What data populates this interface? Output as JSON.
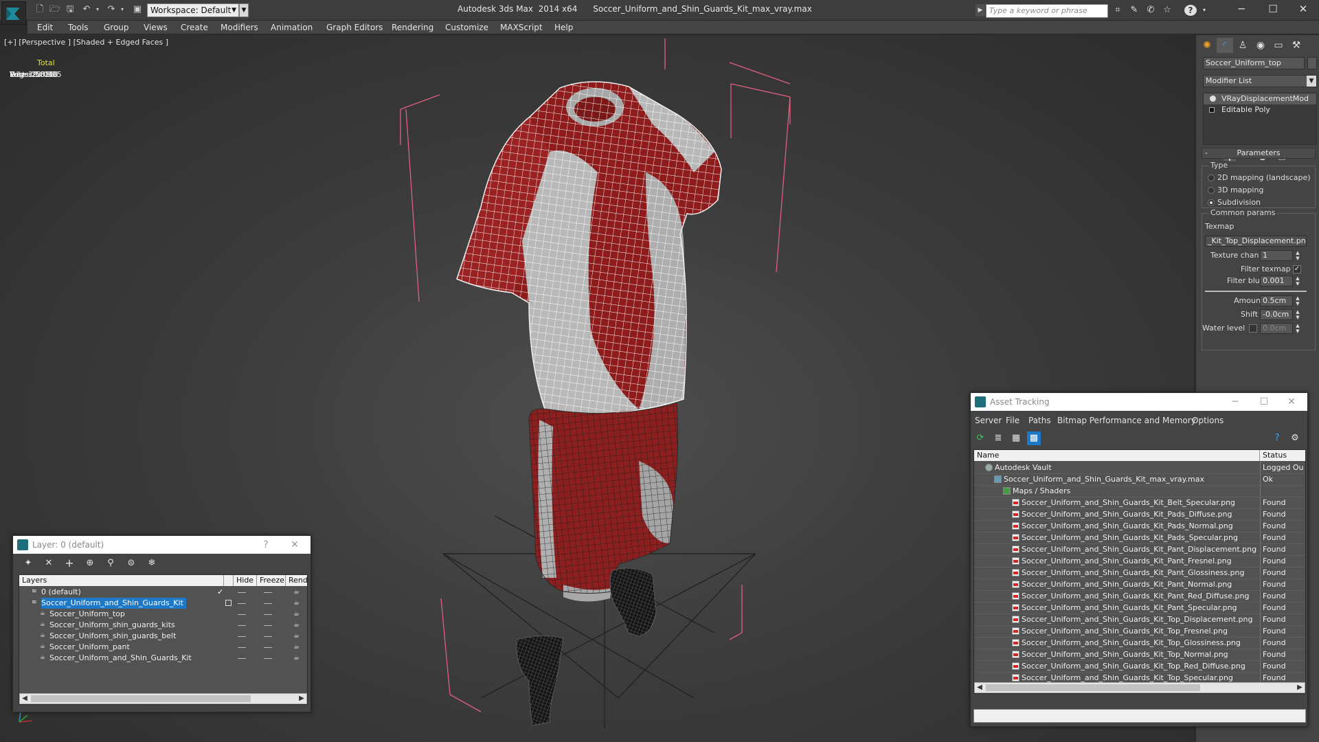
{
  "titlebar": {
    "workspace": "Workspace: Default",
    "app_title": "Autodesk 3ds Max  2014 x64      Soccer_Uniform_and_Shin_Guards_Kit_max_vray.max",
    "search_placeholder": "Type a keyword or phrase"
  },
  "menu": [
    "Edit",
    "Tools",
    "Group",
    "Views",
    "Create",
    "Modifiers",
    "Animation",
    "Graph Editors",
    "Rendering",
    "Customize",
    "MAXScript",
    "Help"
  ],
  "viewport": {
    "label": "[+] [Perspective ] [Shaded + Edged Faces ]",
    "stats": {
      "header": "Total",
      "rows": [
        {
          "k": "Polys:",
          "v": "22 018"
        },
        {
          "k": "Tris:",
          "v": "29 686"
        },
        {
          "k": "Edges:",
          "v": "58 305"
        },
        {
          "k": "Verts:",
          "v": "15 045"
        }
      ]
    }
  },
  "command_panel": {
    "object_name": "Soccer_Uniform_top",
    "modifier_list": "Modifier List",
    "stack": [
      "VRayDisplacementMod",
      "Editable Poly"
    ],
    "parameters_title": "Parameters",
    "type_title": "Type",
    "type_options": [
      "2D mapping (landscape)",
      "3D mapping",
      "Subdivision"
    ],
    "type_selected": 2,
    "common_title": "Common params",
    "texmap_label": "Texmap",
    "texmap_value": "_Kit_Top_Displacement.png)",
    "texture_chan_label": "Texture chan",
    "texture_chan_value": "1",
    "filter_texmap_label": "Filter texmap",
    "filter_blur_label": "Filter blur",
    "filter_blur_value": "0.001",
    "amount_label": "Amount",
    "amount_value": "0.5cm",
    "shift_label": "Shift",
    "shift_value": "-0.0cm",
    "water_label": "Water level",
    "water_value": "0.0cm"
  },
  "layer_dialog": {
    "title": "Layer: 0 (default)",
    "help": "?",
    "close": "✕",
    "columns": [
      "Layers",
      "Hide",
      "Freeze",
      "Render"
    ],
    "rows": [
      {
        "name": "0 (default)",
        "level": 0,
        "checked": true,
        "selected": false
      },
      {
        "name": "Soccer_Uniform_and_Shin_Guards_Kit",
        "level": 0,
        "checked": false,
        "selected": true
      },
      {
        "name": "Soccer_Uniform_top",
        "level": 1,
        "checked": false,
        "selected": false
      },
      {
        "name": "Soccer_Uniform_shin_guards_kits",
        "level": 1,
        "checked": false,
        "selected": false
      },
      {
        "name": "Soccer_Uniform_shin_guards_belt",
        "level": 1,
        "checked": false,
        "selected": false
      },
      {
        "name": "Soccer_Uniform_pant",
        "level": 1,
        "checked": false,
        "selected": false
      },
      {
        "name": "Soccer_Uniform_and_Shin_Guards_Kit",
        "level": 1,
        "checked": false,
        "selected": false
      }
    ]
  },
  "asset_dialog": {
    "title": "Asset Tracking",
    "menu": [
      "Server",
      "File",
      "Paths",
      "Bitmap Performance and Memory",
      "Options"
    ],
    "columns": [
      "Name",
      "Status"
    ],
    "rows": [
      {
        "name": "Autodesk Vault",
        "level": 0,
        "icon": "vault",
        "status": "Logged Ou"
      },
      {
        "name": "Soccer_Uniform_and_Shin_Guards_Kit_max_vray.max",
        "level": 1,
        "icon": "max",
        "status": "Ok"
      },
      {
        "name": "Maps / Shaders",
        "level": 2,
        "icon": "maps",
        "status": ""
      },
      {
        "name": "Soccer_Uniform_and_Shin_Guards_Kit_Belt_Specular.png",
        "level": 3,
        "icon": "png",
        "status": "Found"
      },
      {
        "name": "Soccer_Uniform_and_Shin_Guards_Kit_Pads_Diffuse.png",
        "level": 3,
        "icon": "png",
        "status": "Found"
      },
      {
        "name": "Soccer_Uniform_and_Shin_Guards_Kit_Pads_Normal.png",
        "level": 3,
        "icon": "png",
        "status": "Found"
      },
      {
        "name": "Soccer_Uniform_and_Shin_Guards_Kit_Pads_Specular.png",
        "level": 3,
        "icon": "png",
        "status": "Found"
      },
      {
        "name": "Soccer_Uniform_and_Shin_Guards_Kit_Pant_Displacement.png",
        "level": 3,
        "icon": "png",
        "status": "Found"
      },
      {
        "name": "Soccer_Uniform_and_Shin_Guards_Kit_Pant_Fresnel.png",
        "level": 3,
        "icon": "png",
        "status": "Found"
      },
      {
        "name": "Soccer_Uniform_and_Shin_Guards_Kit_Pant_Glossiness.png",
        "level": 3,
        "icon": "png",
        "status": "Found"
      },
      {
        "name": "Soccer_Uniform_and_Shin_Guards_Kit_Pant_Normal.png",
        "level": 3,
        "icon": "png",
        "status": "Found"
      },
      {
        "name": "Soccer_Uniform_and_Shin_Guards_Kit_Pant_Red_Diffuse.png",
        "level": 3,
        "icon": "png",
        "status": "Found"
      },
      {
        "name": "Soccer_Uniform_and_Shin_Guards_Kit_Pant_Specular.png",
        "level": 3,
        "icon": "png",
        "status": "Found"
      },
      {
        "name": "Soccer_Uniform_and_Shin_Guards_Kit_Top_Displacement.png",
        "level": 3,
        "icon": "png",
        "status": "Found"
      },
      {
        "name": "Soccer_Uniform_and_Shin_Guards_Kit_Top_Fresnel.png",
        "level": 3,
        "icon": "png",
        "status": "Found"
      },
      {
        "name": "Soccer_Uniform_and_Shin_Guards_Kit_Top_Glossiness.png",
        "level": 3,
        "icon": "png",
        "status": "Found"
      },
      {
        "name": "Soccer_Uniform_and_Shin_Guards_Kit_Top_Normal.png",
        "level": 3,
        "icon": "png",
        "status": "Found"
      },
      {
        "name": "Soccer_Uniform_and_Shin_Guards_Kit_Top_Red_Diffuse.png",
        "level": 3,
        "icon": "png",
        "status": "Found"
      },
      {
        "name": "Soccer_Uniform_and_Shin_Guards_Kit_Top_Specular.png",
        "level": 3,
        "icon": "png",
        "status": "Found"
      }
    ]
  },
  "colors": {
    "accent": "#1e78c8",
    "jersey_red": "#8e1c1c",
    "wire": "#ffffff",
    "bbox": "#e06080",
    "stats": "#e0e040"
  }
}
